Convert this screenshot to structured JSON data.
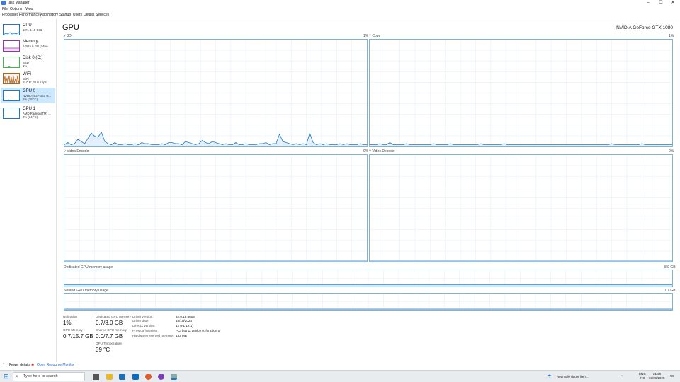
{
  "window": {
    "title": "Task Manager",
    "min_glyph": "–",
    "max_glyph": "☐",
    "close_glyph": "✕"
  },
  "menu": [
    "File",
    "Options",
    "View"
  ],
  "tabs": [
    "Processes",
    "Performance",
    "App history",
    "Startup",
    "Users",
    "Details",
    "Services"
  ],
  "active_tab": "Performance",
  "sidebar": [
    {
      "name": "CPU",
      "line1": "10% 4.10 GHz",
      "line2": "",
      "color": "#1f77c5"
    },
    {
      "name": "Memory",
      "line1": "5.2/15.6 GB (34%)",
      "line2": "",
      "color": "#9b2fae"
    },
    {
      "name": "Disk 0 (C:)",
      "line1": "SSD",
      "line2": "1%",
      "color": "#4caf50"
    },
    {
      "name": "WiFi",
      "line1": "WiFi",
      "line2": "S: 0 R: 32.0 Kbps",
      "color": "#b0651e"
    },
    {
      "name": "GPU 0",
      "line1": "NVIDIA GeForce G...",
      "line2": "1% (38 °C)",
      "color": "#1f77c5"
    },
    {
      "name": "GPU 1",
      "line1": "AMD Radeon(TM) ...",
      "line2": "0% (34 °C)",
      "color": "#1f77c5"
    }
  ],
  "selected_sidebar": "GPU 0",
  "main": {
    "title": "GPU",
    "model": "NVIDIA GeForce GTX 1080",
    "engines": [
      {
        "label": "3D",
        "percent": "1%"
      },
      {
        "label": "Copy",
        "percent": "1%"
      },
      {
        "label": "Video Encode",
        "percent": "0%"
      },
      {
        "label": "Video Decode",
        "percent": "0%"
      }
    ],
    "dedicated_label": "Dedicated GPU memory usage",
    "dedicated_max": "8.0 GB",
    "shared_label": "Shared GPU memory usage",
    "shared_max": "7.7 GB"
  },
  "stats": {
    "utilization_label": "Utilization",
    "utilization": "1%",
    "dedicated_label": "Dedicated GPU memory",
    "dedicated": "0.7/8.0 GB",
    "gpu_memory_label": "GPU Memory",
    "gpu_memory": "0.7/15.7 GB",
    "shared_label": "Shared GPU memory",
    "shared": "0.0/7.7 GB",
    "temp_label": "GPU Temperature",
    "temp": "39 °C",
    "driver_version_label": "Driver version:",
    "driver_version": "32.0.15.6603",
    "driver_date_label": "Driver date:",
    "driver_date": "15/10/2024",
    "directx_label": "DirectX version:",
    "directx": "12 (FL 12.1)",
    "physical_label": "Physical location:",
    "physical": "PCI bus 1, device 0, function 0",
    "reserved_label": "Hardware reserved memory:",
    "reserved": "133 MB"
  },
  "footer": {
    "fewer": "Fewer details",
    "monitor": "Open Resource Monitor"
  },
  "taskbar": {
    "search_placeholder": "Type here to search",
    "weather": "Regnfulle dager frem...",
    "lang1": "ENG",
    "lang2": "NO",
    "time": "21:29",
    "date": "03/06/2025"
  },
  "colors": {
    "accent": "#1f77c5",
    "graph_border": "#7eb3d6",
    "grid": "#e6f0f8",
    "selected_bg": "#cce8ff"
  },
  "chart_data": [
    {
      "type": "line",
      "title": "3D",
      "y_unit": "%",
      "ylim": [
        0,
        100
      ],
      "values": [
        1,
        3,
        1,
        2,
        6,
        4,
        2,
        7,
        12,
        9,
        8,
        13,
        4,
        2,
        1,
        3,
        1,
        1,
        2,
        1,
        1,
        2,
        1,
        3,
        2,
        2,
        1,
        1,
        1,
        2,
        1,
        3,
        3,
        2,
        2,
        1,
        4,
        3,
        2,
        1,
        2,
        5,
        3,
        2,
        4,
        3,
        2,
        1,
        2,
        1,
        1,
        3,
        1,
        1,
        2,
        1,
        1,
        1,
        2,
        2,
        3,
        1,
        2,
        2,
        11,
        4,
        3,
        2,
        1,
        2,
        1,
        2,
        1,
        12,
        3,
        1,
        2,
        1,
        2,
        1,
        1,
        1,
        2,
        1,
        2,
        1,
        1,
        1,
        2,
        1,
        1
      ]
    },
    {
      "type": "line",
      "title": "Copy",
      "y_unit": "%",
      "ylim": [
        0,
        100
      ],
      "values": [
        1,
        1,
        1,
        2,
        1,
        1,
        3,
        1,
        1,
        1,
        1,
        2,
        1,
        1,
        1,
        1,
        1,
        1,
        1,
        2,
        1,
        1,
        1,
        1,
        2,
        1,
        1,
        1,
        1,
        1,
        1,
        1,
        1,
        2,
        1,
        1,
        1,
        1,
        1,
        1,
        2,
        1,
        1,
        1,
        1,
        1,
        1,
        1,
        1,
        1,
        1,
        1,
        1,
        1,
        1,
        1,
        1,
        1,
        1,
        1,
        1,
        1,
        1,
        1,
        1,
        1,
        1,
        1,
        1,
        1,
        1,
        1,
        2,
        1,
        1,
        1,
        1,
        1,
        1,
        1,
        1,
        2,
        1,
        1,
        1,
        1,
        1,
        1,
        1,
        1,
        1
      ]
    },
    {
      "type": "line",
      "title": "Video Encode",
      "y_unit": "%",
      "ylim": [
        0,
        100
      ],
      "values": [
        0,
        0,
        0,
        0,
        0,
        0,
        0,
        0,
        0,
        0
      ]
    },
    {
      "type": "line",
      "title": "Video Decode",
      "y_unit": "%",
      "ylim": [
        0,
        100
      ],
      "values": [
        0,
        0,
        0,
        0,
        0,
        0,
        0,
        0,
        0,
        0
      ]
    },
    {
      "type": "area",
      "title": "Dedicated GPU memory usage",
      "y_unit": "GB",
      "ylim": [
        0,
        8.0
      ],
      "values": [
        0.7,
        0.7,
        0.7,
        0.7,
        0.7,
        0.7,
        0.7,
        0.7,
        0.7,
        0.7
      ]
    },
    {
      "type": "area",
      "title": "Shared GPU memory usage",
      "y_unit": "GB",
      "ylim": [
        0,
        7.7
      ],
      "values": [
        0.0,
        0.0,
        0.0,
        0.0,
        0.0,
        0.0,
        0.0,
        0.0,
        0.0,
        0.0
      ]
    }
  ]
}
